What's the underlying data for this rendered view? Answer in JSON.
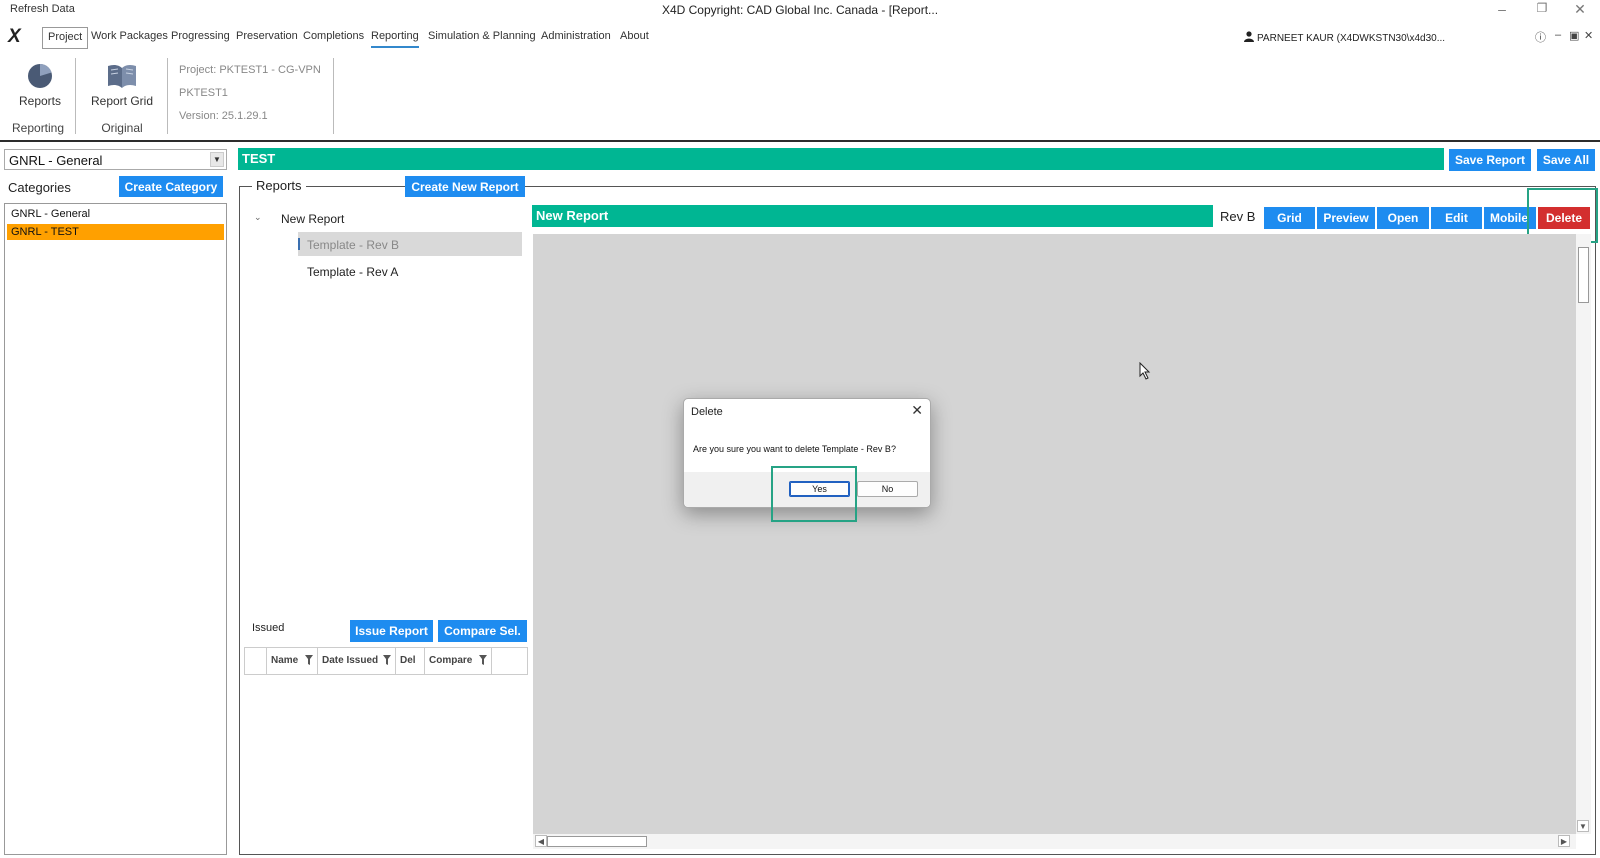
{
  "titlebar": {
    "refresh_label": "Refresh Data",
    "title": "X4D Copyright: CAD Global Inc. Canada - [Report..."
  },
  "menu": {
    "items": [
      "Project",
      "Work Packages",
      "Progressing",
      "Preservation",
      "Completions",
      "Reporting",
      "Simulation & Planning",
      "Administration",
      "About"
    ],
    "active": "Reporting"
  },
  "user": {
    "name": "PARNEET KAUR (X4DWKSTN30\\x4d30..."
  },
  "ribbon": {
    "reports_label": "Reports",
    "report_grid_label": "Report Grid",
    "group_reporting": "Reporting",
    "group_original": "Original",
    "project_line": "Project: PKTEST1 - CG-VPN",
    "project_code": "PKTEST1",
    "version": "Version: 25.1.29.1"
  },
  "left": {
    "combo_value": "GNRL - General",
    "categories_label": "Categories",
    "create_category": "Create Category",
    "categories": [
      "GNRL - General",
      "GNRL - TEST"
    ],
    "selected_category": "GNRL - TEST"
  },
  "main": {
    "header": "TEST",
    "save_report": "Save Report",
    "save_all": "Save All",
    "reports_group": "Reports",
    "create_new_report": "Create New Report",
    "tree_root": "New Report",
    "tree_items": [
      "Template - Rev B",
      "Template - Rev A"
    ],
    "tree_selected": "Template - Rev B",
    "issued_label": "Issued",
    "issue_report": "Issue Report",
    "compare_sel": "Compare Sel.",
    "issued_columns": [
      "Name",
      "Date Issued",
      "Del",
      "Compare"
    ]
  },
  "report_view": {
    "title": "New Report",
    "revision": "Rev B",
    "actions": [
      "Grid",
      "Preview",
      "Open",
      "Edit",
      "Mobile"
    ],
    "delete": "Delete"
  },
  "dialog": {
    "title": "Delete",
    "message": "Are you sure you want to delete Template - Rev B?",
    "yes": "Yes",
    "no": "No"
  },
  "colors": {
    "accent_blue": "#1e8cf0",
    "header_green": "#00b693",
    "selection_orange": "#ffa000",
    "delete_red": "#d32f2f",
    "highlight_green": "#26a385"
  }
}
